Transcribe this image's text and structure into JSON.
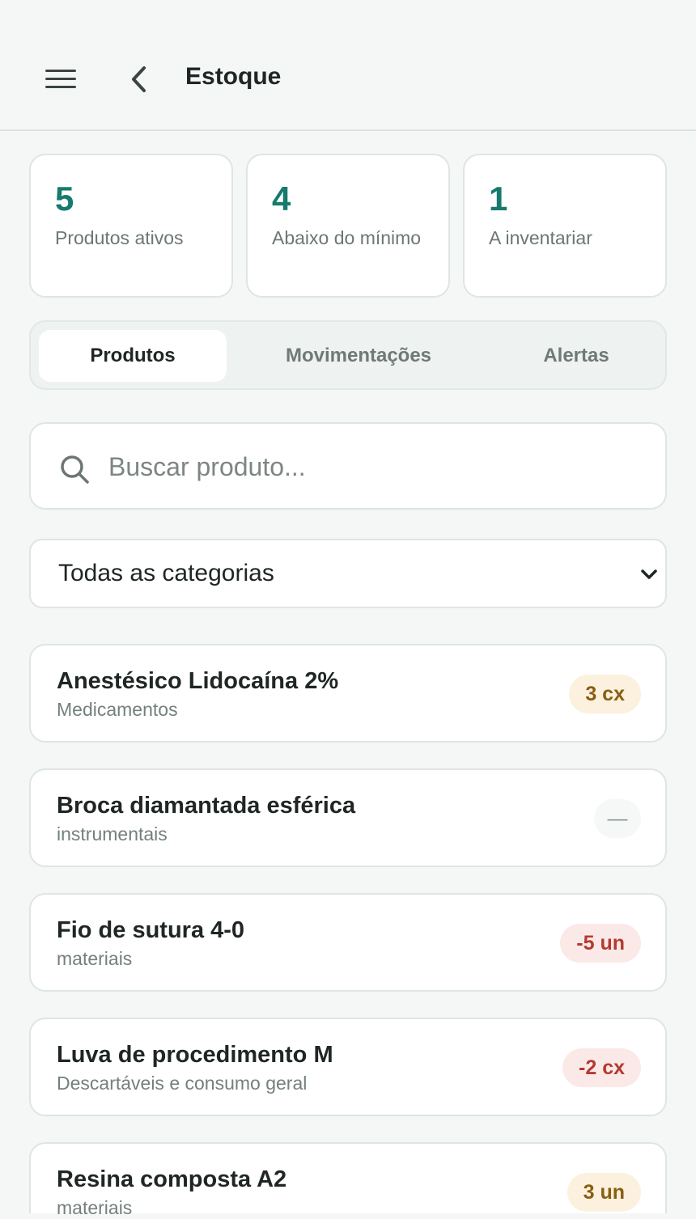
{
  "header": {
    "title": "Estoque",
    "menu_icon": "menu-icon",
    "back_icon": "chevron-left-icon"
  },
  "stats": [
    {
      "value": "5",
      "label": "Produtos ativos"
    },
    {
      "value": "4",
      "label": "Abaixo do mínimo"
    },
    {
      "value": "1",
      "label": "A inventariar"
    }
  ],
  "tabs": [
    {
      "label": "Produtos",
      "active": true
    },
    {
      "label": "Movimentações",
      "active": false
    },
    {
      "label": "Alertas",
      "active": false
    }
  ],
  "search": {
    "placeholder": "Buscar produto...",
    "value": "",
    "icon": "search-icon"
  },
  "category_filter": {
    "selected": "Todas as categorias",
    "icon": "chevron-down-icon"
  },
  "products": [
    {
      "name": "Anestésico Lidocaína 2%",
      "category": "Medicamentos",
      "quantity": "3 cx",
      "status": "warning"
    },
    {
      "name": "Broca diamantada esférica",
      "category": "instrumentais",
      "quantity": "—",
      "status": "none"
    },
    {
      "name": "Fio de sutura 4-0",
      "category": "materiais",
      "quantity": "-5 un",
      "status": "danger"
    },
    {
      "name": "Luva de procedimento M",
      "category": "Descartáveis e consumo geral",
      "quantity": "-2 cx",
      "status": "danger"
    },
    {
      "name": "Resina composta A2",
      "category": "materiais",
      "quantity": "3 un",
      "status": "warning"
    }
  ],
  "colors": {
    "accent": "#167a6e",
    "background": "#f4f7f6",
    "warning_bg": "#fbf1de",
    "warning_text": "#8a5d12",
    "danger_bg": "#fbe9e8",
    "danger_text": "#b33a31"
  }
}
